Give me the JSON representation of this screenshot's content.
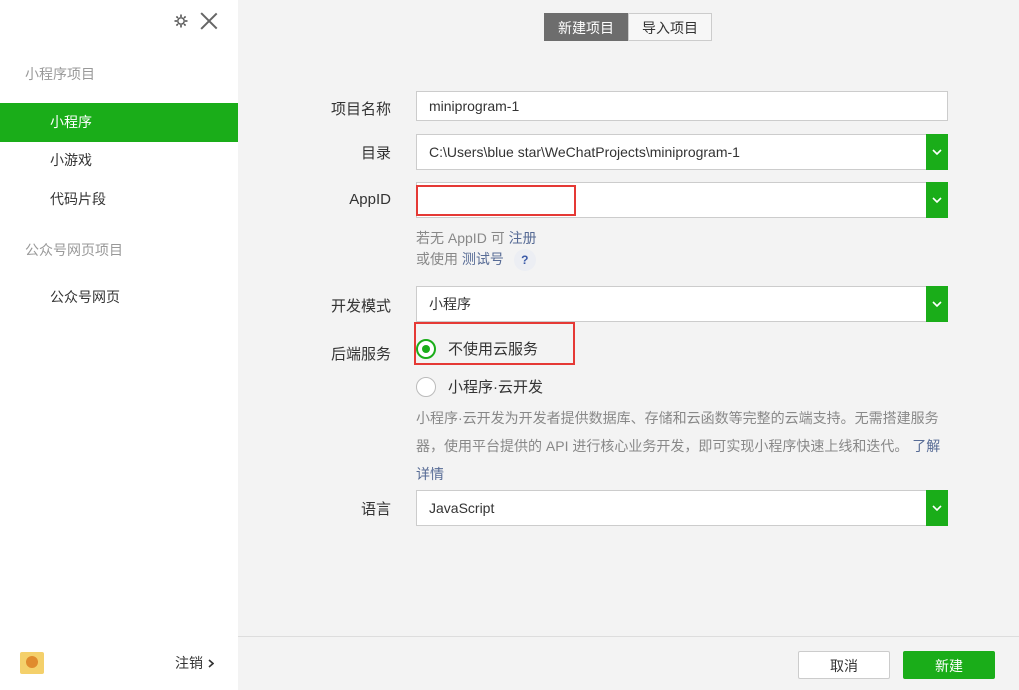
{
  "sidebar": {
    "sections": [
      {
        "title": "小程序项目"
      },
      {
        "title": "公众号网页项目"
      }
    ],
    "items": [
      {
        "label": "小程序"
      },
      {
        "label": "小游戏"
      },
      {
        "label": "代码片段"
      },
      {
        "label": "公众号网页"
      }
    ],
    "logout_label": "注销"
  },
  "tabs": {
    "new_project": "新建项目",
    "import_project": "导入项目"
  },
  "form": {
    "project_name": {
      "label": "项目名称",
      "value": "miniprogram-1"
    },
    "directory": {
      "label": "目录",
      "value": "C:\\Users\\blue star\\WeChatProjects\\miniprogram-1"
    },
    "appid": {
      "label": "AppID",
      "value": "",
      "hint_no_appid": "若无 AppID 可",
      "hint_register": "注册",
      "hint_or_use": "或使用",
      "hint_test": "测试号",
      "help": "?"
    },
    "dev_mode": {
      "label": "开发模式",
      "value": "小程序"
    },
    "backend": {
      "label": "后端服务",
      "option_none": "不使用云服务",
      "option_cloud": "小程序·云开发",
      "description": "小程序·云开发为开发者提供数据库、存储和云函数等完整的云端支持。无需搭建服务器，使用平台提供的 API 进行核心业务开发，即可实现小程序快速上线和迭代。",
      "learn_more": "了解详情"
    },
    "language": {
      "label": "语言",
      "value": "JavaScript"
    }
  },
  "buttons": {
    "cancel": "取消",
    "create": "新建"
  },
  "colors": {
    "accent": "#1aad19",
    "highlight": "#e53935",
    "link": "#576b95"
  }
}
